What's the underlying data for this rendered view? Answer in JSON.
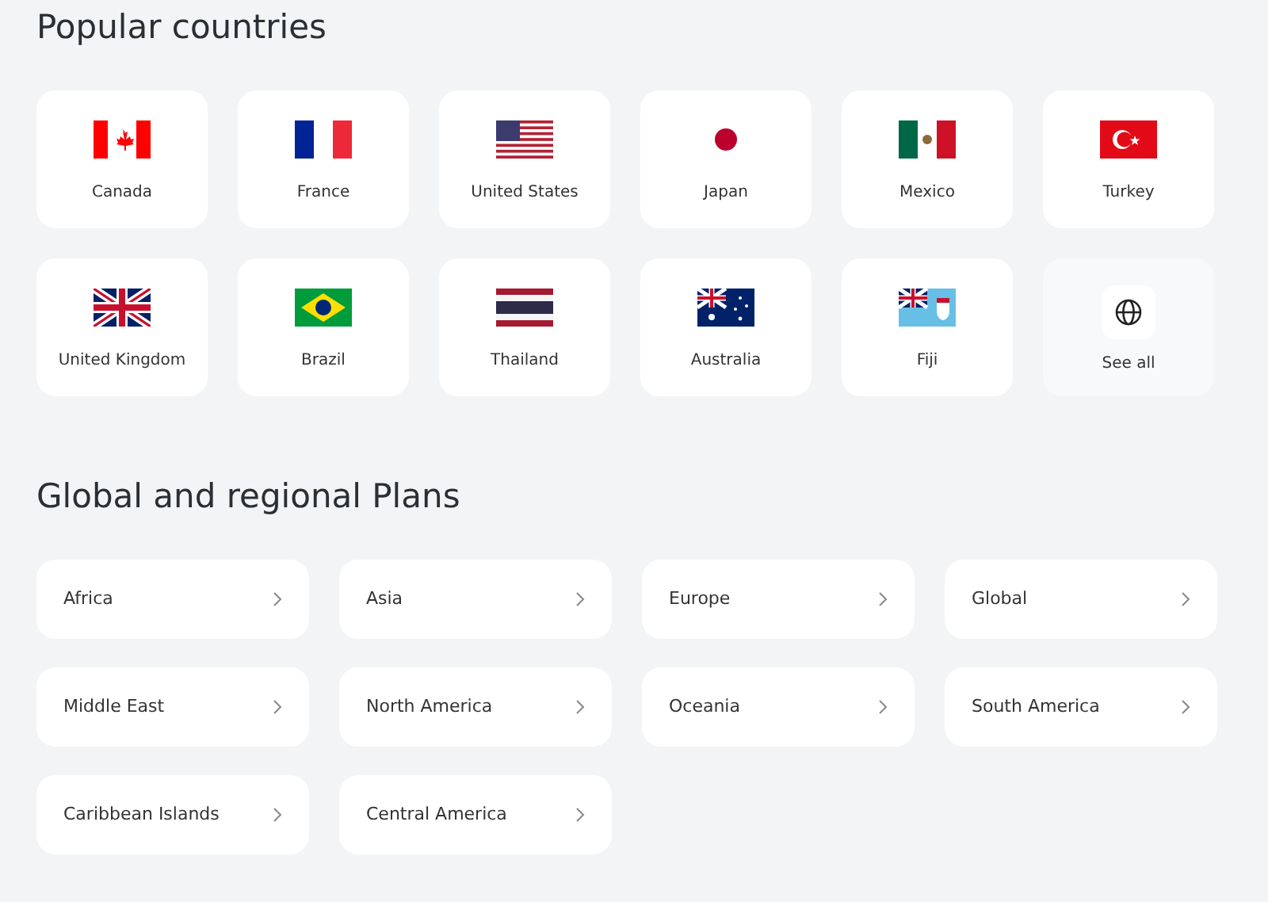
{
  "popular": {
    "title": "Popular countries",
    "items": [
      {
        "kind": "flag",
        "label": "Canada"
      },
      {
        "kind": "flag",
        "label": "France"
      },
      {
        "kind": "flag",
        "label": "United States"
      },
      {
        "kind": "flag",
        "label": "Japan"
      },
      {
        "kind": "flag",
        "label": "Mexico"
      },
      {
        "kind": "flag",
        "label": "Turkey"
      },
      {
        "kind": "flag",
        "label": "United Kingdom"
      },
      {
        "kind": "flag",
        "label": "Brazil"
      },
      {
        "kind": "flag",
        "label": "Thailand"
      },
      {
        "kind": "flag",
        "label": "Australia"
      },
      {
        "kind": "flag",
        "label": "Fiji"
      },
      {
        "kind": "more",
        "label": "See all"
      }
    ]
  },
  "regions": {
    "title": "Global and regional Plans",
    "items": [
      {
        "label": "Africa"
      },
      {
        "label": "Asia"
      },
      {
        "label": "Europe"
      },
      {
        "label": "Global"
      },
      {
        "label": "Middle East"
      },
      {
        "label": "North America"
      },
      {
        "label": "Oceania"
      },
      {
        "label": "South America"
      },
      {
        "label": "Caribbean Islands"
      },
      {
        "label": "Central America"
      }
    ]
  }
}
